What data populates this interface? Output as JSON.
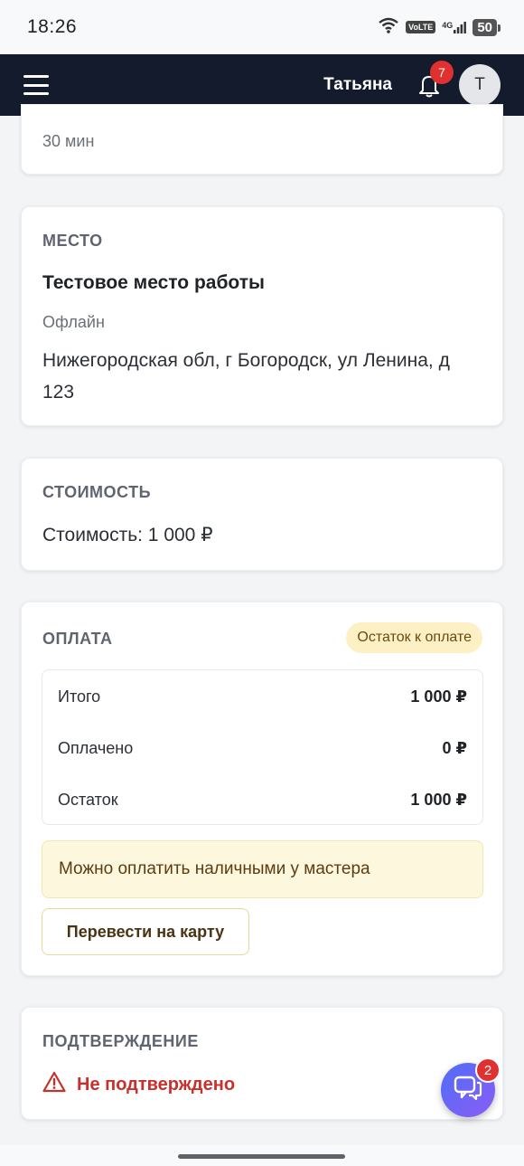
{
  "status_bar": {
    "time": "18:26",
    "volte": "VoLTE",
    "network": "4G",
    "battery": "50"
  },
  "header": {
    "user_name": "Татьяна",
    "notifications_count": "7",
    "avatar_initial": "Т"
  },
  "duration": {
    "value": "30 мин"
  },
  "place": {
    "title": "МЕСТО",
    "name": "Тестовое место работы",
    "format": "Офлайн",
    "address": "Нижегородская обл, г Богородск, ул Ленина, д 123"
  },
  "cost": {
    "title": "СТОИМОСТЬ",
    "text": "Стоимость: 1 000 ₽"
  },
  "payment": {
    "title": "ОПЛАТА",
    "status_badge": "Остаток к оплате",
    "rows": [
      {
        "label": "Итого",
        "value": "1 000 ₽"
      },
      {
        "label": "Оплачено",
        "value": "0 ₽"
      },
      {
        "label": "Остаток",
        "value": "1 000 ₽"
      }
    ],
    "cash_note": "Можно оплатить наличными у мастера",
    "transfer_button": "Перевести на карту"
  },
  "confirmation": {
    "title": "ПОДТВЕРЖДЕНИЕ",
    "status": "Не подтверждено"
  },
  "chat": {
    "unread_count": "2"
  },
  "colors": {
    "navbar": "#141b2d",
    "badge_red": "#e03131",
    "warning_bg": "#fdf7dd",
    "status_badge_bg": "#fdf0c4",
    "error_text": "#c9302c",
    "chat_gradient_start": "#4f6ef7",
    "chat_gradient_end": "#8b5cf6"
  }
}
